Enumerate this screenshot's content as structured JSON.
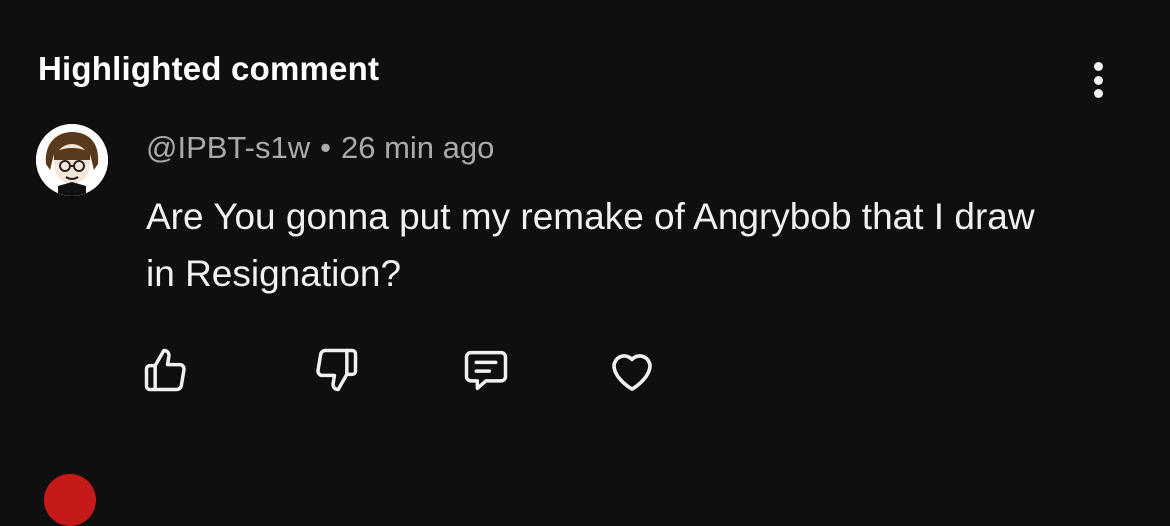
{
  "header": {
    "title": "Highlighted comment",
    "more_icon": "more-vertical-icon"
  },
  "comment": {
    "avatar_icon": "user-avatar",
    "username": "@IPBT-s1w",
    "separator": "•",
    "timestamp": "26 min ago",
    "text": "Are You gonna put my remake of Angrybob that I draw in Resignation?"
  },
  "actions": [
    {
      "name": "like-button",
      "icon": "thumbs-up-icon"
    },
    {
      "name": "dislike-button",
      "icon": "thumbs-down-icon"
    },
    {
      "name": "reply-button",
      "icon": "comment-icon"
    },
    {
      "name": "heart-button",
      "icon": "heart-icon"
    }
  ],
  "colors": {
    "background": "#0f0f0f",
    "primary_text": "#f1f1f1",
    "secondary_text": "#aaaaaa",
    "next_avatar": "#c61a1a"
  }
}
